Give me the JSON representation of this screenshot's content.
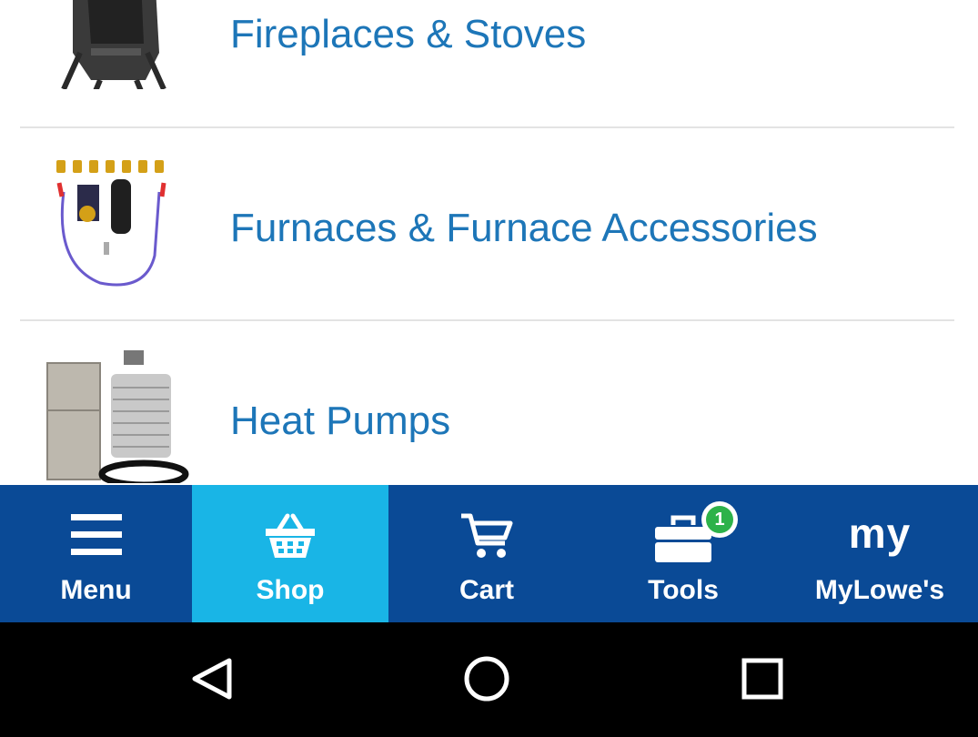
{
  "categories": [
    {
      "label": "Fireplaces & Stoves",
      "icon": "stove-thumbnail"
    },
    {
      "label": "Furnaces & Furnace Accessories",
      "icon": "furnace-parts-thumbnail"
    },
    {
      "label": "Heat Pumps",
      "icon": "heat-pump-thumbnail"
    }
  ],
  "tabbar": {
    "menu": {
      "label": "Menu",
      "icon": "hamburger-icon"
    },
    "shop": {
      "label": "Shop",
      "icon": "basket-icon",
      "active": true
    },
    "cart": {
      "label": "Cart",
      "icon": "cart-icon"
    },
    "tools": {
      "label": "Tools",
      "icon": "toolbox-icon",
      "badge": "1"
    },
    "mylowes": {
      "label": "MyLowe's",
      "icon_text": "my"
    }
  },
  "navbar": {
    "back": "back-icon",
    "home": "home-icon",
    "recents": "recents-icon"
  },
  "colors": {
    "link": "#1d76b8",
    "tabbar": "#0a4a96",
    "active_tab": "#19b5e6",
    "badge": "#2db24a"
  }
}
